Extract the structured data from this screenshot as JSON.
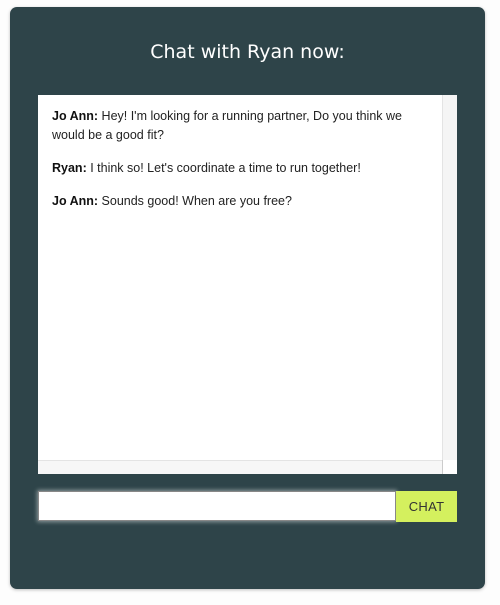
{
  "header": {
    "title": "Chat with Ryan now:"
  },
  "messages": [
    {
      "sender": "Jo Ann:",
      "text": " Hey! I'm looking for a running partner, Do you think we would be a good fit?"
    },
    {
      "sender": "Ryan:",
      "text": " I think so! Let's coordinate a time to run together!"
    },
    {
      "sender": "Jo Ann:",
      "text": " Sounds good! When are you free?"
    }
  ],
  "composer": {
    "value": "",
    "placeholder": "",
    "send_label": "CHAT"
  },
  "colors": {
    "panel": "#2e4449",
    "button": "#d4f05e"
  }
}
